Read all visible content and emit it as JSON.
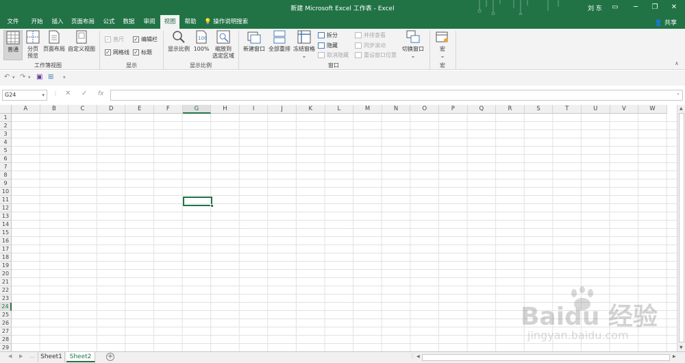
{
  "titlebar": {
    "title": "新建 Microsoft Excel 工作表 - Excel",
    "user": "刘 东"
  },
  "tabs": [
    "文件",
    "开始",
    "插入",
    "页面布局",
    "公式",
    "数据",
    "审阅",
    "视图",
    "帮助"
  ],
  "tell_me": "操作说明搜索",
  "share": "共享",
  "ribbon": {
    "workbook_views": {
      "normal": "普通",
      "page_break_1": "分页",
      "page_break_2": "预览",
      "page_layout": "页面布局",
      "custom_views": "自定义视图",
      "label": "工作簿视图"
    },
    "show": {
      "ruler": "直尺",
      "formula_bar": "编辑栏",
      "gridlines": "网格线",
      "headings": "标题",
      "label": "显示"
    },
    "zoom": {
      "zoom": "显示比例",
      "hundred": "100%",
      "zoom_sel_1": "缩放到",
      "zoom_sel_2": "选定区域",
      "label": "显示比例"
    },
    "window": {
      "new_window": "新建窗口",
      "arrange_all": "全部重排",
      "freeze_panes": "冻结窗格",
      "split": "拆分",
      "hide": "隐藏",
      "unhide": "取消隐藏",
      "side_by_side": "并排查看",
      "sync_scroll": "同步滚动",
      "reset_position": "重设窗口位置",
      "switch_windows": "切换窗口",
      "label": "窗口"
    },
    "macros": {
      "macros": "宏",
      "label": "宏"
    }
  },
  "formula_bar": {
    "name_box": "G24",
    "fx": "fx",
    "value": ""
  },
  "columns": [
    "A",
    "B",
    "C",
    "D",
    "E",
    "F",
    "G",
    "H",
    "I",
    "J",
    "K",
    "L",
    "M",
    "N",
    "O",
    "P",
    "Q",
    "R",
    "S",
    "T",
    "U",
    "V",
    "W"
  ],
  "rows": [
    "1",
    "2",
    "3",
    "4",
    "5",
    "6",
    "7",
    "8",
    "9",
    "10",
    "11",
    "12",
    "13",
    "14",
    "15",
    "16",
    "17",
    "18",
    "19",
    "20",
    "21",
    "22",
    "23",
    "24",
    "25",
    "26",
    "27",
    "28",
    "29"
  ],
  "selected_cell": {
    "column": "G",
    "row": "24"
  },
  "sheets": [
    "Sheet1",
    "Sheet2"
  ],
  "active_sheet": "Sheet2",
  "watermark": {
    "brand": "Baidu 经验",
    "url": "jingyan.baidu.com"
  },
  "colors": {
    "accent": "#217346",
    "ribbon_bg": "#f3f3f3",
    "grid": "#e1e1e1"
  }
}
